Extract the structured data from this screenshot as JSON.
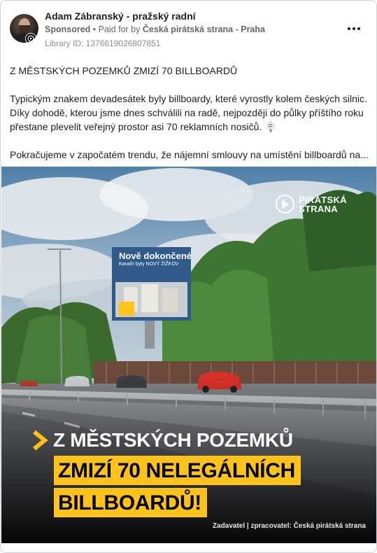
{
  "post": {
    "author": "Adam Zábranský - pražský radní",
    "sponsored": "Sponsored",
    "separator": " • ",
    "paid_for_by": "Paid for by",
    "payer": "Česká pirátská strana - Praha",
    "library_id": "Library ID: 1376619026807851",
    "more_icon": "more-horizontal-icon",
    "body": {
      "headline": "Z MĚSTSKÝCH POZEMKŮ ZMIZÍ 70 BILLBOARDŮ",
      "paragraph1": "Typickým znakem devadesátek byly billboardy, které vyrostly kolem českých silnic. Díky dohodě, kterou jsme dnes schválili na radě, nejpozději do půlky příštího roku přestane plevelit veřejný prostor asi 70 reklamních nosičů. 🪧",
      "paragraph2": "Pokračujeme v započatém trendu, že nájemní smlouvy na umístění billboardů na..."
    }
  },
  "image": {
    "logo_line1": "PIRÁTSKÁ",
    "logo_line2": "STRANA",
    "billboard_title": "Nově dokončené",
    "billboard_sub": "Kavalír byty NOVÝ ŽIŽKOV",
    "headline_line1": "Z MĚSTSKÝCH POZEMKŮ",
    "headline_line2": "ZMIZÍ 70 NELEGÁLNÍCH",
    "headline_line3": "BILLBOARDŮ!",
    "credit": "Zadavatel | zpracovatel: Česká pirátská strana",
    "colors": {
      "accent_yellow": "#fec21b",
      "meta_gray": "#65676b"
    }
  }
}
